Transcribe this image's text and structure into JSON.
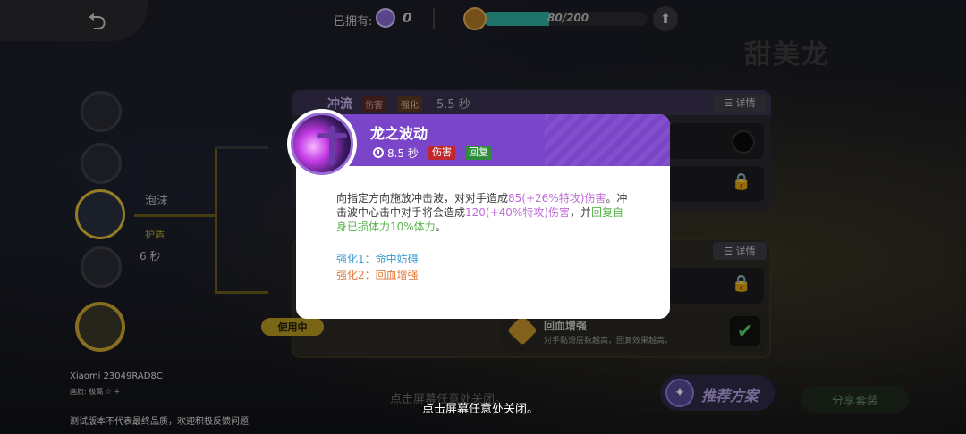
{
  "header": {
    "owned_label": "已拥有:",
    "owned_count": "0",
    "progress_text": "80/200",
    "progress_fraction": 0.4,
    "pet_name": "甜美龙"
  },
  "left": {
    "bubble_label": "泡沫",
    "shield_label": "护盾",
    "cooldown": "6 秒",
    "device_name": "Xiaomi 23049RAD8C",
    "quality": "画质: 极高 ☆ +",
    "test_note": "测试版本不代表最终品质，欢迎积极反馈问题"
  },
  "bg_panel": {
    "skill_name": "冲流",
    "tag_damage": "伤害",
    "tag_enhance": "强化",
    "cooldown": "5.5 秒",
    "detail_label": "☰ 详情",
    "detail_label_2": "☰ 详情",
    "in_use": "使用中",
    "option_title": "回血增强",
    "option_desc": "对手黏滑层数越高，回复效果越高。",
    "close_hint_bg": "点击屏幕任意处关闭。"
  },
  "buttons": {
    "recommend": "推荐方案",
    "share": "分享套装"
  },
  "tooltip": {
    "title": "龙之波动",
    "cooldown": "8.5 秒",
    "tag_damage": "伤害",
    "tag_heal": "回复",
    "desc_p1": "向指定方向施放冲击波，对对手造成",
    "desc_v1": "85(+26%特攻)伤害",
    "desc_p2": "。冲击波中心击中对手将会造成",
    "desc_v2": "120(+40%特攻)伤害",
    "desc_p3": "，并",
    "desc_v3": "回复自身已损体力10%体力",
    "desc_p4": "。",
    "enhance1": "强化1：命中妨碍",
    "enhance2": "强化2：回血增强"
  },
  "close_hint": "点击屏幕任意处关闭。",
  "colors": {
    "header_purple": "#7a45c8",
    "damage_red": "#c1272d",
    "heal_green": "#2e8b3c",
    "value_pink": "#c06bd8",
    "enhance1_blue": "#3a9bd2",
    "enhance2_orange": "#e07a3a"
  }
}
